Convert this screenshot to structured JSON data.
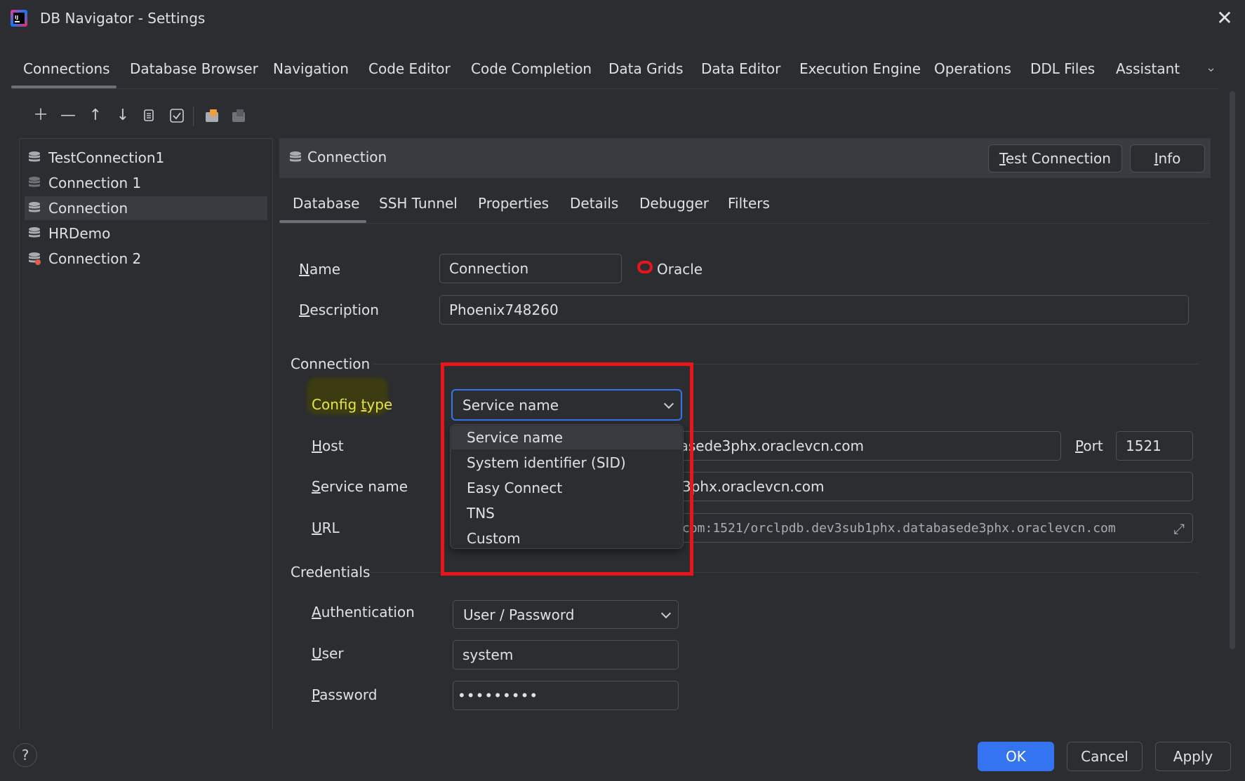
{
  "window": {
    "title": "DB Navigator - Settings",
    "close_icon": "close-icon",
    "app_icon": "intellij-app-icon"
  },
  "top_tabs": [
    {
      "label": "Connections",
      "active": true
    },
    {
      "label": "Database Browser"
    },
    {
      "label": "Navigation"
    },
    {
      "label": "Code Editor"
    },
    {
      "label": "Code Completion"
    },
    {
      "label": "Data Grids"
    },
    {
      "label": "Data Editor"
    },
    {
      "label": "Execution Engine"
    },
    {
      "label": "Operations"
    },
    {
      "label": "DDL Files"
    },
    {
      "label": "Assistant"
    }
  ],
  "toolbar": {
    "icons": [
      "add-icon",
      "remove-icon",
      "move-up-icon",
      "move-down-icon",
      "copy-icon",
      "check-icon",
      "export-icon",
      "import-icon"
    ]
  },
  "connections": [
    {
      "label": "TestConnection1",
      "icon": "database-icon"
    },
    {
      "label": "Connection 1",
      "icon": "database-icon"
    },
    {
      "label": "Connection",
      "icon": "database-icon",
      "selected": true
    },
    {
      "label": "HRDemo",
      "icon": "database-icon"
    },
    {
      "label": "Connection 2",
      "icon": "database-error-icon"
    }
  ],
  "panel": {
    "title": "Connection",
    "test_connection_prefix": "T",
    "test_connection_rest": "est Connection",
    "info_prefix": "I",
    "info_rest": "nfo"
  },
  "sub_tabs": [
    {
      "label": "Database",
      "active": true
    },
    {
      "label": "SSH Tunnel"
    },
    {
      "label": "Properties"
    },
    {
      "label": "Details"
    },
    {
      "label": "Debugger"
    },
    {
      "label": "Filters"
    }
  ],
  "form": {
    "name": {
      "label_mnemonic": "N",
      "label_rest": "ame",
      "value": "Connection",
      "db_type": "Oracle"
    },
    "description": {
      "label_mnemonic": "D",
      "label_rest": "escription",
      "value": "Phoenix748260"
    },
    "connection_section": "Connection",
    "config_type": {
      "label_pre": "Config ",
      "label_mnemonic": "t",
      "label_rest": "ype",
      "value": "Service name",
      "options": [
        "Service name",
        "System identifier (SID)",
        "Easy Connect",
        "TNS",
        "Custom"
      ],
      "selected_index": 0
    },
    "host": {
      "label_mnemonic": "H",
      "label_rest": "ost",
      "value_visible": "abasede3phx.oraclevcn.com"
    },
    "port": {
      "label_mnemonic": "P",
      "label_rest": "ort",
      "value": "1521"
    },
    "service_name": {
      "label_mnemonic": "S",
      "label_rest": "ervice name",
      "value_visible": "3phx.oraclevcn.com"
    },
    "url": {
      "label_mnemonic": "U",
      "label_rest": "RL",
      "value_visible": "com:1521/orclpdb.dev3sub1phx.databasede3phx.oraclevcn.com"
    },
    "credentials_section": "Credentials",
    "authentication": {
      "label_mnemonic": "A",
      "label_rest": "uthentication",
      "value": "User / Password"
    },
    "user": {
      "label_mnemonic": "U",
      "label_rest": "ser",
      "value": "system"
    },
    "password": {
      "label_mnemonic": "P",
      "label_rest": "assword",
      "value": "•••••••••"
    }
  },
  "footer": {
    "help": "?",
    "ok": "OK",
    "cancel": "Cancel",
    "apply": "Apply"
  },
  "colors": {
    "accent": "#3574f0",
    "highlight_box": "#e8161b",
    "config_label": "#e5e54a",
    "background": "#2b2d30"
  }
}
